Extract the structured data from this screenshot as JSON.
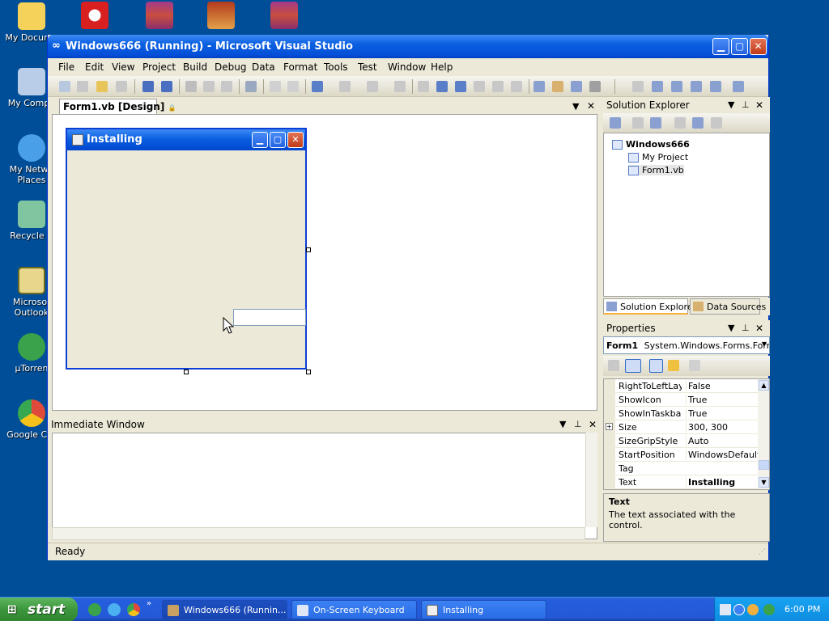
{
  "desktop": {
    "icons": [
      {
        "label": "My Docume",
        "color": "#f5d25a"
      },
      {
        "label": "My Compu",
        "color": "#b9cde8"
      },
      {
        "label": "My Netwo",
        "label2": "Places",
        "color": "#4aa0e8"
      },
      {
        "label": "Recycle B",
        "color": "#7fc6a0"
      },
      {
        "label": "Microsof",
        "label2": "Outlook",
        "color": "#e8d78a"
      },
      {
        "label": "µTorren",
        "color": "#3aa24a"
      },
      {
        "label": "Google Chr",
        "color": "#e04a3a"
      }
    ]
  },
  "vs": {
    "title": "Windows666 (Running) - Microsoft Visual Studio",
    "menu": [
      "File",
      "Edit",
      "View",
      "Project",
      "Build",
      "Debug",
      "Data",
      "Format",
      "Tools",
      "Test",
      "Window",
      "Help"
    ],
    "doc_tab": "Form1.vb [Design]",
    "form": {
      "title": "Installing"
    },
    "immediate": {
      "title": "Immediate Window"
    },
    "solution_explorer": {
      "title": "Solution Explorer",
      "project": "Windows666",
      "items": [
        "My Project",
        "Form1.vb"
      ],
      "tabs": [
        "Solution Explorer",
        "Data Sources"
      ]
    },
    "properties": {
      "title": "Properties",
      "object_name": "Form1",
      "object_type": "System.Windows.Forms.Form",
      "rows": [
        {
          "name": "RightToLeftLayo",
          "value": "False"
        },
        {
          "name": "ShowIcon",
          "value": "True"
        },
        {
          "name": "ShowInTaskbar",
          "value": "True"
        },
        {
          "name": "Size",
          "value": "300, 300"
        },
        {
          "name": "SizeGripStyle",
          "value": "Auto"
        },
        {
          "name": "StartPosition",
          "value": "WindowsDefaultLo"
        },
        {
          "name": "Tag",
          "value": ""
        },
        {
          "name": "Text",
          "value": "Installing"
        }
      ],
      "desc_title": "Text",
      "desc_text": "The text associated with the control."
    },
    "status": "Ready"
  },
  "taskbar": {
    "start_label": "start",
    "tasks": [
      "Windows666 (Runnin...",
      "On-Screen Keyboard",
      "Installing"
    ],
    "clock": "6:00 PM"
  },
  "colors": {
    "desktop": "#004e98",
    "xp_blue": "#0a5fe0",
    "start_green": "#3c963c"
  }
}
